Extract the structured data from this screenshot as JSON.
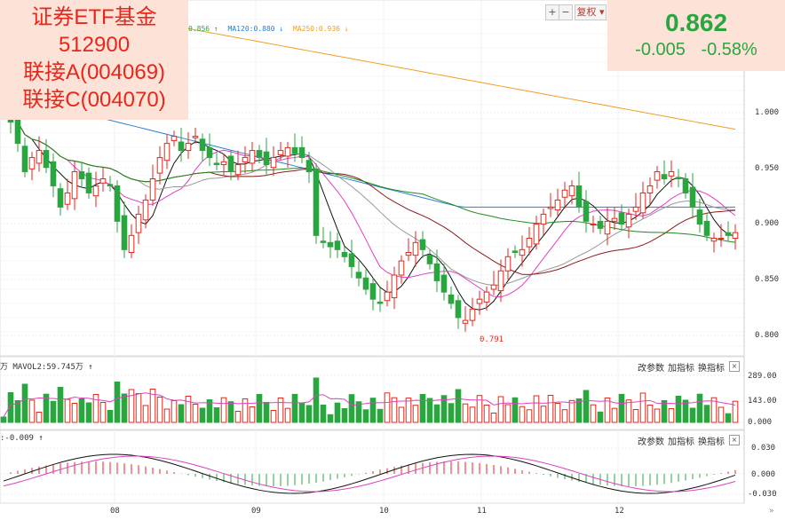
{
  "title": {
    "line1": "证券ETF基金",
    "line2": "512900",
    "line3": "联接A(004069)",
    "line4": "联接C(004070)"
  },
  "quote": {
    "price": "0.862",
    "change": "-0.005",
    "change_pct": "-0.58%"
  },
  "toolbar": {
    "zoom_in": "+",
    "zoom_out": "−",
    "adjust": "复权 ▾"
  },
  "ma_legend": [
    {
      "text": "0.856 ↑",
      "color": "#2aa640"
    },
    {
      "text": "MA120:0.880 ↓",
      "color": "#2a7fd4"
    },
    {
      "text": "MA250:0.936 ↓",
      "color": "#f0a020"
    }
  ],
  "price_axis": [
    "1.000",
    "0.950",
    "0.900",
    "0.850",
    "0.800"
  ],
  "low_marker": "0.791",
  "volume_panel": {
    "legend": "万  MAVOL2:59.745万 ↑",
    "axis": [
      "289.00",
      "143.00",
      "0.000"
    ]
  },
  "macd_panel": {
    "legend": ":-0.009 ↑",
    "axis": [
      "0.030",
      "0.000",
      "-0.030"
    ]
  },
  "panel_buttons": {
    "change_params": "改参数",
    "add_indicator": "加指标",
    "switch_indicator": "换指标",
    "close": "×"
  },
  "x_axis": [
    "08",
    "09",
    "10",
    "11",
    "12"
  ],
  "scroll_arrow": "»",
  "colors": {
    "up": "#e8271b",
    "down": "#2aa640",
    "ma5": "#111111",
    "ma10": "#e040c0",
    "ma20": "#999999",
    "ma30": "#8b1a1a",
    "ma60": "#1e8c1e",
    "ma120": "#2a7fd4",
    "ma250": "#f0a020"
  },
  "chart_data": {
    "type": "candlestick",
    "price_range": [
      0.775,
      1.025
    ],
    "closes": [
      0.955,
      0.94,
      0.925,
      0.905,
      0.915,
      0.92,
      0.908,
      0.895,
      0.88,
      0.89,
      0.905,
      0.9,
      0.89,
      0.895,
      0.9,
      0.895,
      0.87,
      0.85,
      0.86,
      0.875,
      0.885,
      0.9,
      0.915,
      0.925,
      0.93,
      0.92,
      0.925,
      0.93,
      0.92,
      0.915,
      0.91,
      0.912,
      0.905,
      0.91,
      0.915,
      0.92,
      0.915,
      0.91,
      0.915,
      0.92,
      0.922,
      0.918,
      0.915,
      0.905,
      0.86,
      0.855,
      0.852,
      0.85,
      0.845,
      0.838,
      0.83,
      0.822,
      0.815,
      0.812,
      0.82,
      0.832,
      0.842,
      0.848,
      0.855,
      0.85,
      0.84,
      0.828,
      0.82,
      0.812,
      0.802,
      0.8,
      0.808,
      0.815,
      0.82,
      0.825,
      0.835,
      0.845,
      0.848,
      0.85,
      0.858,
      0.868,
      0.875,
      0.88,
      0.885,
      0.892,
      0.895,
      0.88,
      0.87,
      0.868,
      0.865,
      0.87,
      0.872,
      0.868,
      0.875,
      0.88,
      0.89,
      0.895,
      0.905,
      0.9,
      0.905,
      0.9,
      0.89,
      0.88,
      0.868,
      0.86,
      0.858,
      0.858,
      0.86,
      0.862
    ]
  }
}
